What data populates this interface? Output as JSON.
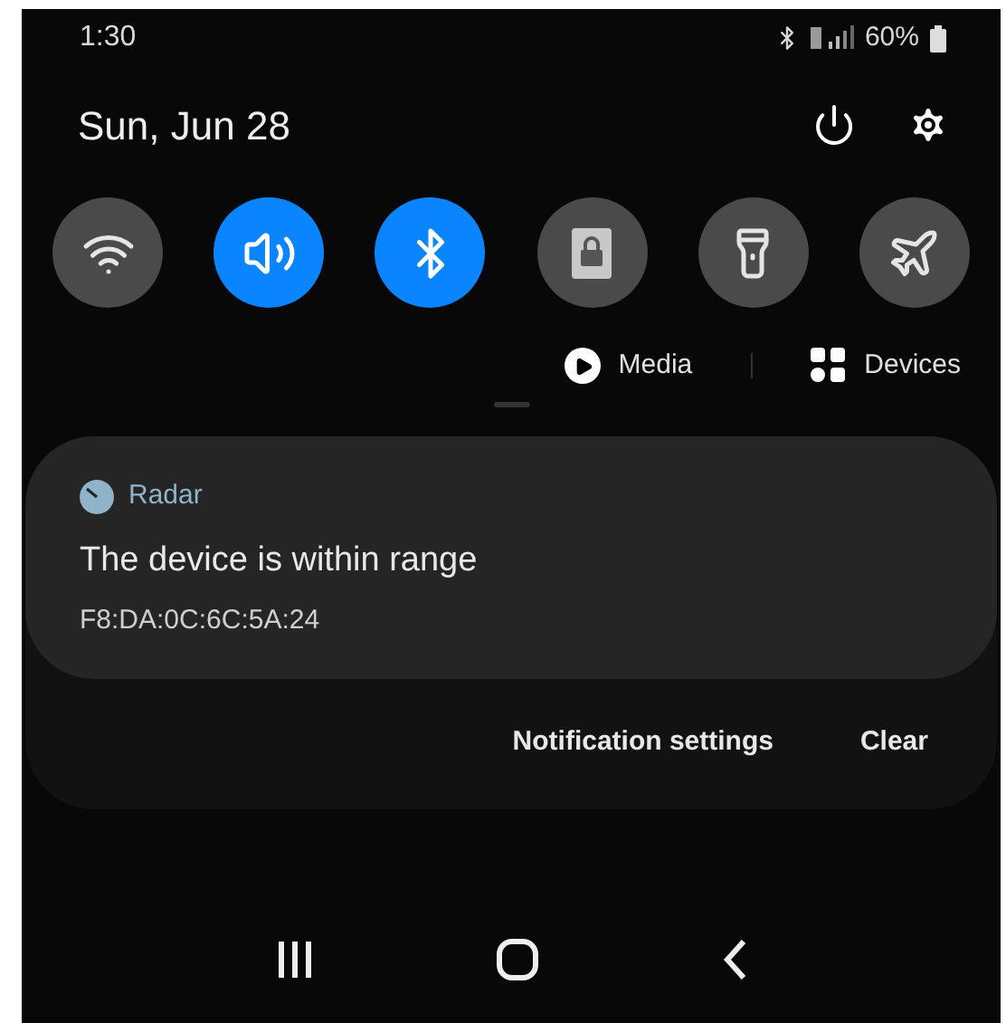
{
  "status_bar": {
    "time": "1:30",
    "battery": "60%"
  },
  "header": {
    "date": "Sun, Jun 28"
  },
  "quick_tiles": [
    {
      "kind": "wifi",
      "on": false
    },
    {
      "kind": "sound",
      "on": true
    },
    {
      "kind": "bluetooth",
      "on": true
    },
    {
      "kind": "lock",
      "on": false
    },
    {
      "kind": "flashlight",
      "on": false
    },
    {
      "kind": "airplane",
      "on": false
    }
  ],
  "media_row": {
    "media": "Media",
    "devices": "Devices"
  },
  "notification": {
    "app": "Radar",
    "title": "The device is within range",
    "text": "F8:DA:0C:6C:5A:24"
  },
  "actions": [
    "Notification settings",
    "Clear"
  ]
}
